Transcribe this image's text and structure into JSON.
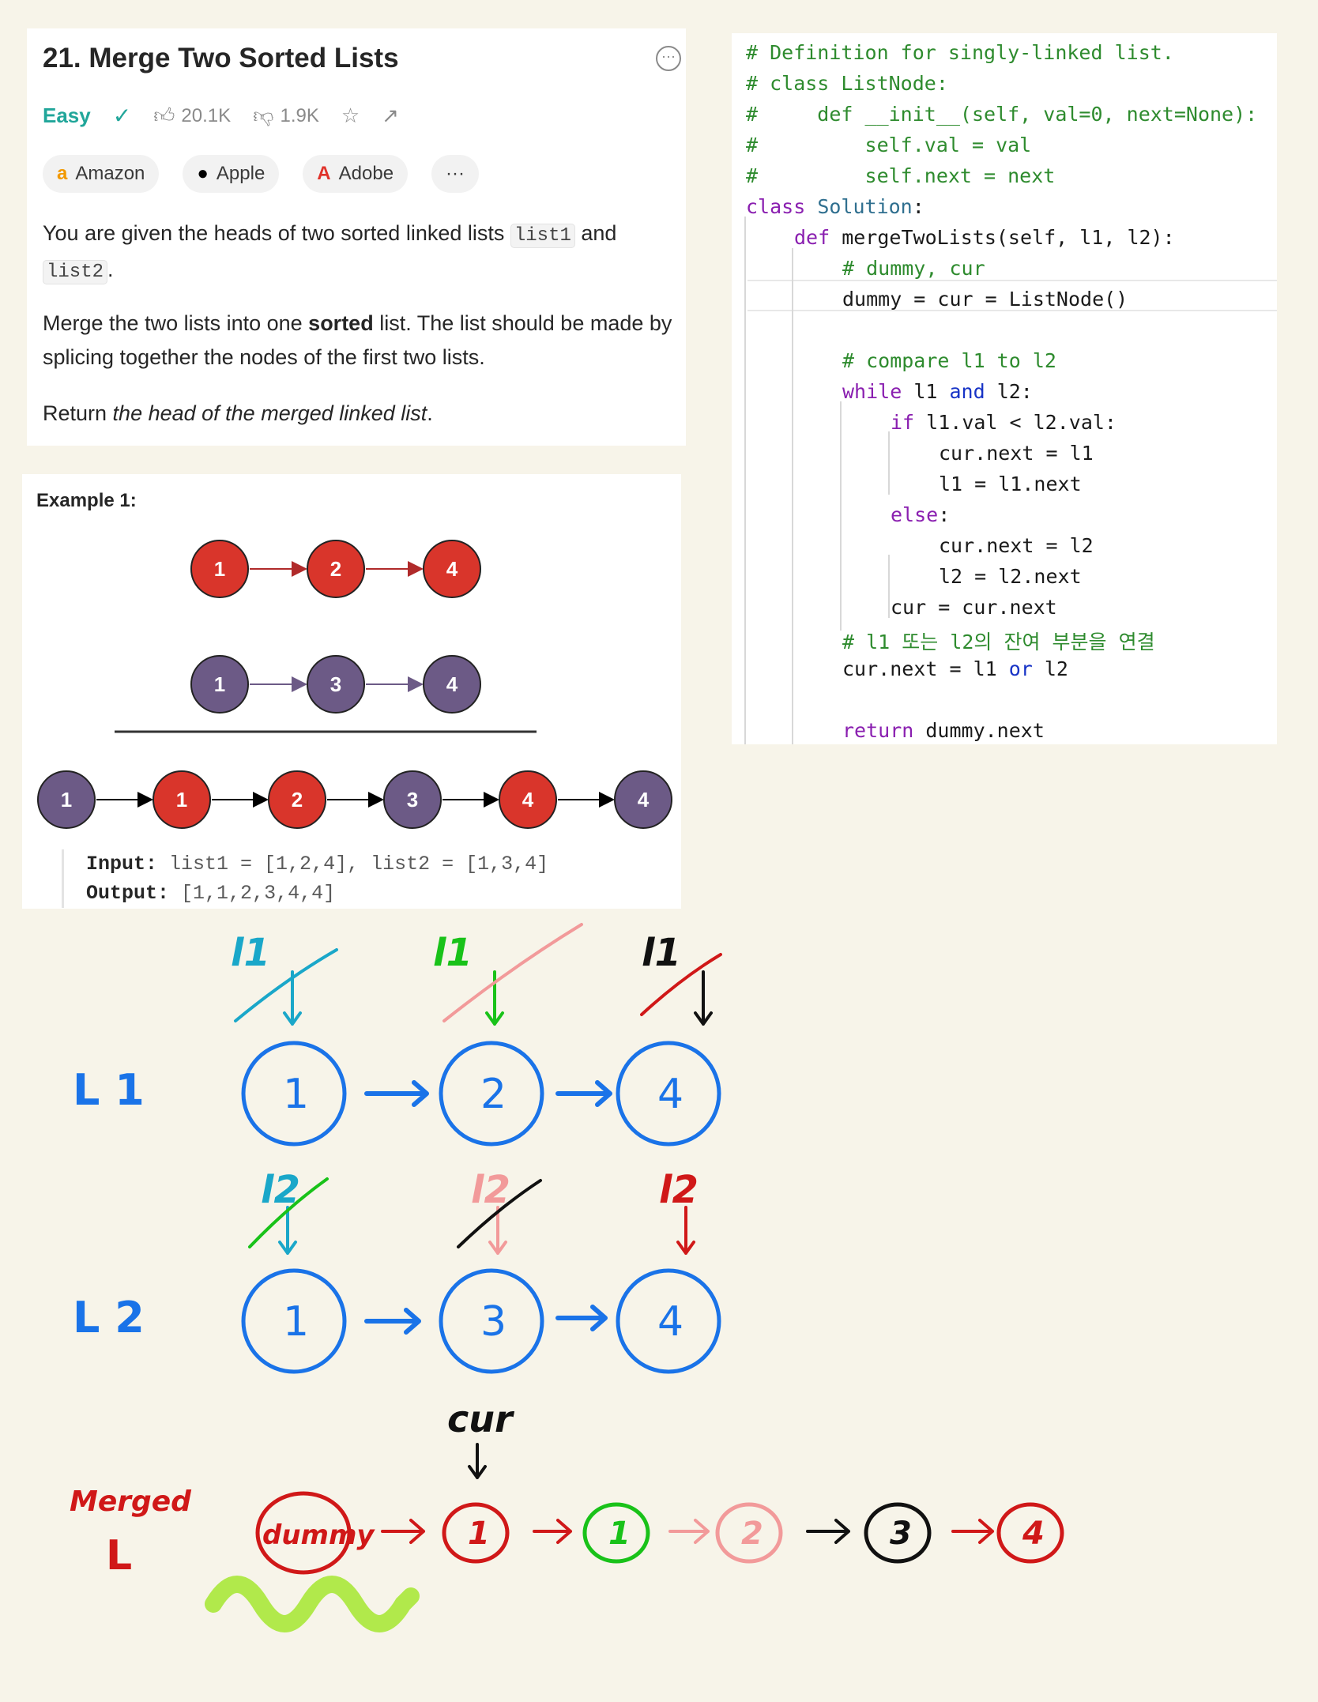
{
  "problem": {
    "title": "21. Merge Two Sorted Lists",
    "difficulty": "Easy",
    "likes": "20.1K",
    "dislikes": "1.9K",
    "tags": [
      "Amazon",
      "Apple",
      "Adobe"
    ],
    "more_label": "···",
    "desc1_pre": "You are given the heads of two sorted linked lists ",
    "desc1_code1": "list1",
    "desc1_mid": " and ",
    "desc1_code2": "list2",
    "desc1_post": ".",
    "desc2_pre": "Merge the two lists into one ",
    "desc2_bold": "sorted",
    "desc2_post": " list. The list should be made by splicing together the nodes of the first two lists.",
    "desc3_pre": "Return ",
    "desc3_italic": "the head of the merged linked list",
    "desc3_post": "."
  },
  "example": {
    "title": "Example 1:",
    "list1": [
      "1",
      "2",
      "4"
    ],
    "list2": [
      "1",
      "3",
      "4"
    ],
    "merged": [
      "1",
      "1",
      "2",
      "3",
      "4",
      "4"
    ],
    "input_label": "Input:",
    "input_value": "list1 = [1,2,4], list2 = [1,3,4]",
    "output_label": "Output:",
    "output_value": "[1,1,2,3,4,4]",
    "colors": {
      "red": "#d9352b",
      "purple": "#6c5a86"
    }
  },
  "code": {
    "lines": [
      "# Definition for singly-linked list.",
      "# class ListNode:",
      "#     def __init__(self, val=0, next=None):",
      "#         self.val = val",
      "#         self.next = next",
      "class Solution:",
      "def mergeTwoLists(self, l1, l2):",
      "# dummy, cur",
      "dummy = cur = ListNode()",
      "# compare l1 to l2",
      "while l1 and l2:",
      "if l1.val < l2.val:",
      "cur.next = l1",
      "l1 = l1.next",
      "else:",
      "cur.next = l2",
      "l2 = l2.next",
      "cur = cur.next",
      "# l1 또는 l2의 잔여 부분을 연결",
      "cur.next = l1 or l2",
      "return dummy.next"
    ]
  },
  "sketch": {
    "label_l1": "L 1",
    "label_l2": "L 2",
    "label_merged_1": "Merged",
    "label_merged_2": "L",
    "l1_nodes": [
      "1",
      "2",
      "4"
    ],
    "l2_nodes": [
      "1",
      "3",
      "4"
    ],
    "pointer_l1": "l1",
    "pointer_l2": "l2",
    "pointer_cur": "cur",
    "merged_nodes": [
      "dummy",
      "1",
      "1",
      "2",
      "3",
      "4"
    ],
    "colors": {
      "blue": "#1a73e8",
      "red": "#d01818",
      "green": "#19c219",
      "pink": "#f29a9a",
      "teal": "#1aa7c9",
      "black": "#111111"
    }
  }
}
